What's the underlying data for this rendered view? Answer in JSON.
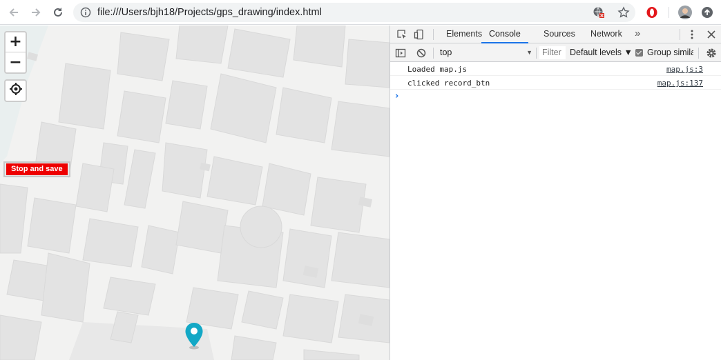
{
  "browser": {
    "url": "file:///Users/bjh18/Projects/gps_drawing/index.html",
    "icons": [
      "back-arrow-icon",
      "forward-arrow-icon",
      "reload-icon",
      "info-icon",
      "translate-blocked-icon",
      "star-icon",
      "opera-icon",
      "profile-avatar",
      "update-icon"
    ]
  },
  "map": {
    "zoom_in": "+",
    "zoom_out": "−",
    "record_button": "Stop and save",
    "marker_color": "#13a8c6"
  },
  "devtools": {
    "tabs": [
      {
        "label": "Elements",
        "active": false
      },
      {
        "label": "Console",
        "active": true
      },
      {
        "label": "Sources",
        "active": false
      },
      {
        "label": "Network",
        "active": false
      }
    ],
    "more_tabs": "»",
    "context": "top",
    "filter_placeholder": "Filter",
    "levels": "Default levels ▼",
    "group_similar": "Group similar",
    "logs": [
      {
        "message": "Loaded map.js",
        "source": "map.js:3"
      },
      {
        "message": "clicked record_btn",
        "source": "map.js:137"
      }
    ],
    "prompt": "›"
  },
  "colors": {
    "accent": "#1a73e8",
    "record_red": "#ee0000"
  }
}
